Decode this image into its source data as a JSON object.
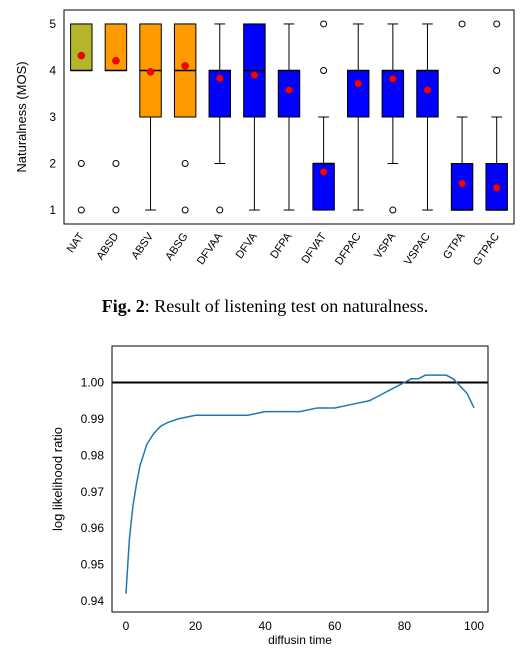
{
  "caption": {
    "figlabel": "Fig. 2",
    "text": ": Result of listening test on naturalness."
  },
  "chart_data": [
    {
      "type": "box",
      "ylabel": "Naturalness (MOS)",
      "ylim": [
        0.7,
        5.3
      ],
      "yticks": [
        1,
        2,
        3,
        4,
        5
      ],
      "categories": [
        "NAT",
        "ABSD",
        "ABSV",
        "ABSG",
        "DFVAA",
        "DFVA",
        "DFPA",
        "DFVAT",
        "DFPAC",
        "VSPA",
        "VSPAC",
        "GTPA",
        "GTPAC"
      ],
      "boxes": [
        {
          "q1": 4,
          "med": 4,
          "q3": 5,
          "lo": 4,
          "hi": 5,
          "mean": 4.32,
          "fliers": [
            1,
            2
          ],
          "color": "#b5b52a"
        },
        {
          "q1": 4,
          "med": 4,
          "q3": 5,
          "lo": 4,
          "hi": 5,
          "mean": 4.21,
          "fliers": [
            1,
            2
          ],
          "color": "#ff9a00"
        },
        {
          "q1": 3,
          "med": 4,
          "q3": 5,
          "lo": 1,
          "hi": 5,
          "mean": 3.97,
          "fliers": [],
          "color": "#ff9a00"
        },
        {
          "q1": 3,
          "med": 4,
          "q3": 5,
          "lo": 3,
          "hi": 5,
          "mean": 4.1,
          "fliers": [
            1,
            2
          ],
          "color": "#ff9a00"
        },
        {
          "q1": 3,
          "med": 4,
          "q3": 4,
          "lo": 2,
          "hi": 5,
          "mean": 3.83,
          "fliers": [
            1
          ],
          "color": "#0000ff"
        },
        {
          "q1": 3,
          "med": 4,
          "q3": 5,
          "lo": 1,
          "hi": 5,
          "mean": 3.9,
          "fliers": [],
          "color": "#0000ff"
        },
        {
          "q1": 3,
          "med": 4,
          "q3": 4,
          "lo": 1,
          "hi": 5,
          "mean": 3.58,
          "fliers": [],
          "color": "#0000ff"
        },
        {
          "q1": 1,
          "med": 2,
          "q3": 2,
          "lo": 1,
          "hi": 3,
          "mean": 1.82,
          "fliers": [
            4,
            5
          ],
          "color": "#0000ff"
        },
        {
          "q1": 3,
          "med": 4,
          "q3": 4,
          "lo": 1,
          "hi": 5,
          "mean": 3.72,
          "fliers": [],
          "color": "#0000ff"
        },
        {
          "q1": 3,
          "med": 4,
          "q3": 4,
          "lo": 2,
          "hi": 5,
          "mean": 3.82,
          "fliers": [
            1
          ],
          "color": "#0000ff"
        },
        {
          "q1": 3,
          "med": 4,
          "q3": 4,
          "lo": 1,
          "hi": 5,
          "mean": 3.58,
          "fliers": [],
          "color": "#0000ff"
        },
        {
          "q1": 1,
          "med": 1,
          "q3": 2,
          "lo": 1,
          "hi": 3,
          "mean": 1.57,
          "fliers": [
            5
          ],
          "color": "#0000ff"
        },
        {
          "q1": 1,
          "med": 1,
          "q3": 2,
          "lo": 1,
          "hi": 3,
          "mean": 1.48,
          "fliers": [
            4,
            5
          ],
          "color": "#0000ff"
        }
      ]
    },
    {
      "type": "line",
      "xlabel": "diffusin time",
      "ylabel": "log likelihood ratio",
      "xlim": [
        -4,
        104
      ],
      "ylim": [
        0.937,
        1.01
      ],
      "xticks": [
        0,
        20,
        40,
        60,
        80,
        100
      ],
      "yticks": [
        0.94,
        0.95,
        0.96,
        0.97,
        0.98,
        0.99,
        1.0
      ],
      "hline": 1.0,
      "x": [
        0,
        1,
        2,
        3,
        4,
        5,
        6,
        8,
        10,
        12,
        15,
        20,
        25,
        30,
        35,
        40,
        45,
        50,
        55,
        60,
        65,
        70,
        72,
        74,
        76,
        78,
        80,
        82,
        84,
        86,
        88,
        90,
        92,
        94,
        95,
        96,
        97,
        98,
        99,
        100
      ],
      "y": [
        0.942,
        0.957,
        0.966,
        0.972,
        0.977,
        0.98,
        0.983,
        0.986,
        0.988,
        0.989,
        0.99,
        0.991,
        0.991,
        0.991,
        0.991,
        0.992,
        0.992,
        0.992,
        0.993,
        0.993,
        0.994,
        0.995,
        0.996,
        0.997,
        0.998,
        0.999,
        1.0,
        1.001,
        1.001,
        1.002,
        1.002,
        1.002,
        1.002,
        1.001,
        1.0,
        0.999,
        0.998,
        0.997,
        0.995,
        0.993
      ]
    }
  ]
}
